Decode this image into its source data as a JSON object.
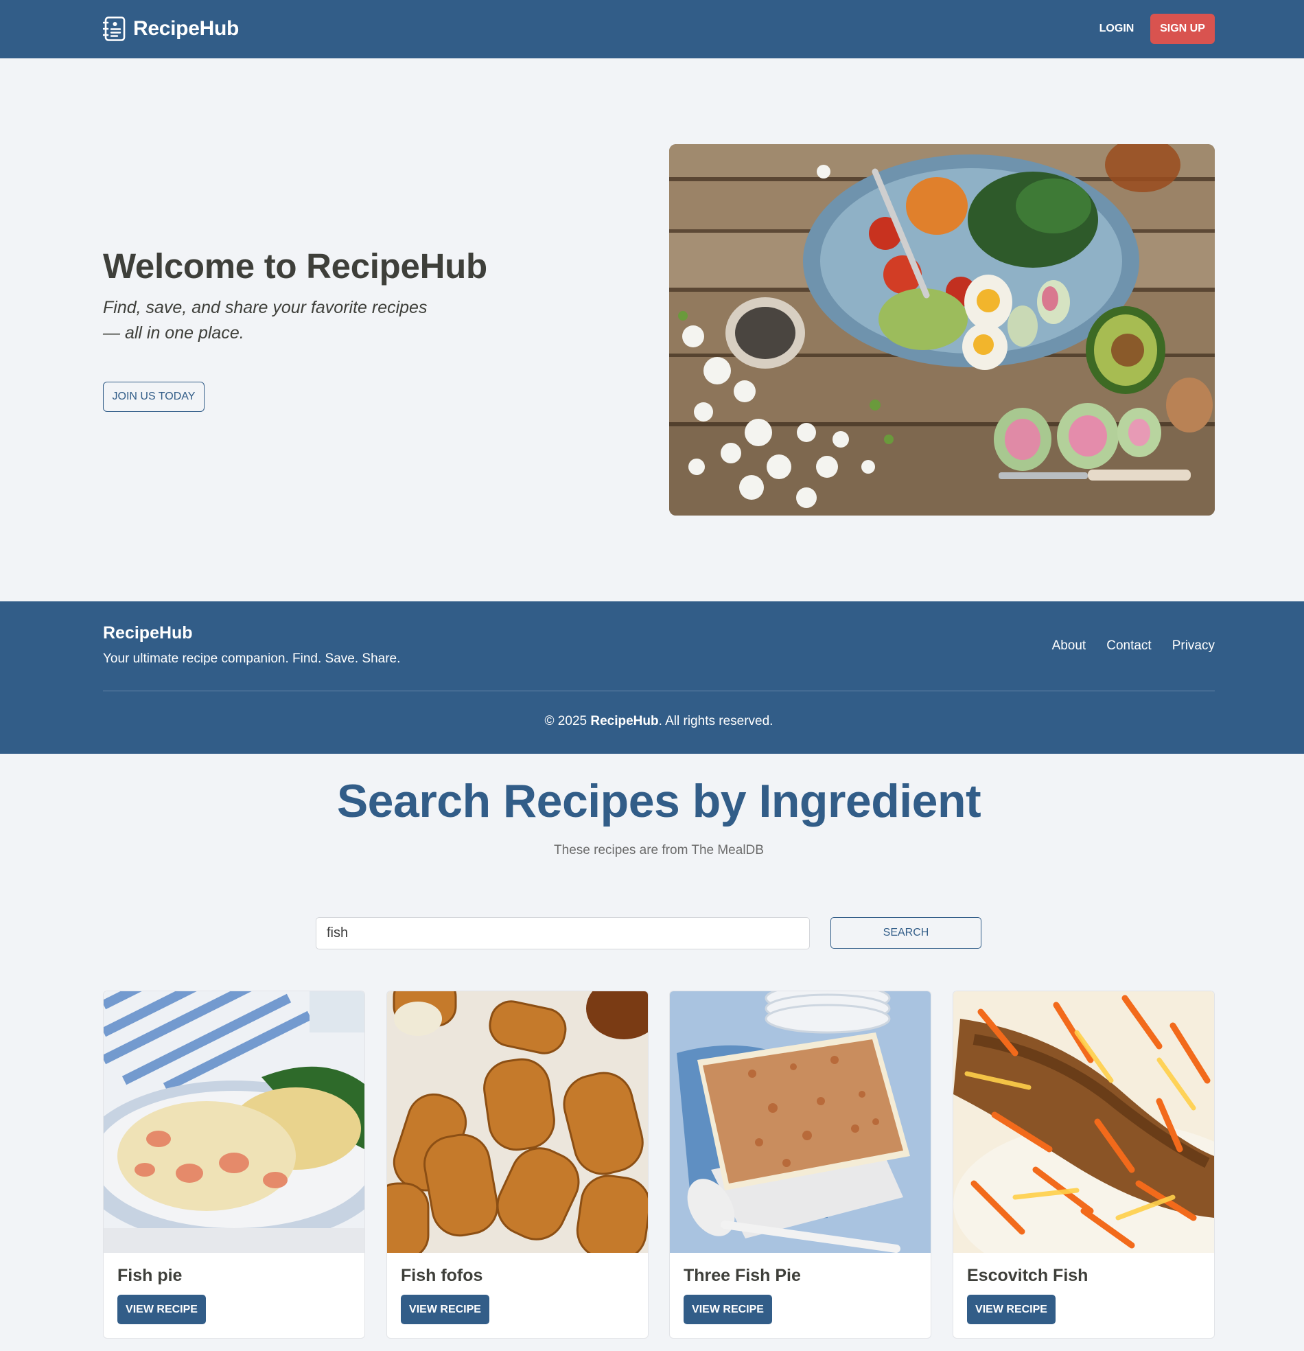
{
  "navbar": {
    "brand": "RecipeHub",
    "brand_icon": "recipe-book-icon",
    "login_label": "LOGIN",
    "signup_label": "SIGN UP",
    "colors": {
      "primary": "#325d88",
      "danger": "#d9534f"
    }
  },
  "hero": {
    "title": "Welcome to RecipeHub",
    "subtitle_line1": "Find, save, and share your favorite recipes",
    "subtitle_line2": "— all in one place.",
    "cta_label": "JOIN US TODAY",
    "image_icon": "salad-bowl-photo"
  },
  "footer": {
    "brand": "RecipeHub",
    "tagline": "Your ultimate recipe companion. Find. Save. Share.",
    "links": [
      "About",
      "Contact",
      "Privacy"
    ],
    "copyright_prefix": "© 2025 ",
    "copyright_brand": "RecipeHub",
    "copyright_suffix": ". All rights reserved."
  },
  "search": {
    "title": "Search Recipes by Ingredient",
    "subtitle": "These recipes are from The MealDB",
    "query": "fish",
    "button_label": "SEARCH"
  },
  "recipes": [
    {
      "name": "Fish pie",
      "button_label": "VIEW RECIPE",
      "image_icon": "fish-pie-photo"
    },
    {
      "name": "Fish fofos",
      "button_label": "VIEW RECIPE",
      "image_icon": "fish-fofos-photo"
    },
    {
      "name": "Three Fish Pie",
      "button_label": "VIEW RECIPE",
      "image_icon": "three-fish-pie-photo"
    },
    {
      "name": "Escovitch Fish",
      "button_label": "VIEW RECIPE",
      "image_icon": "escovitch-fish-photo"
    }
  ]
}
